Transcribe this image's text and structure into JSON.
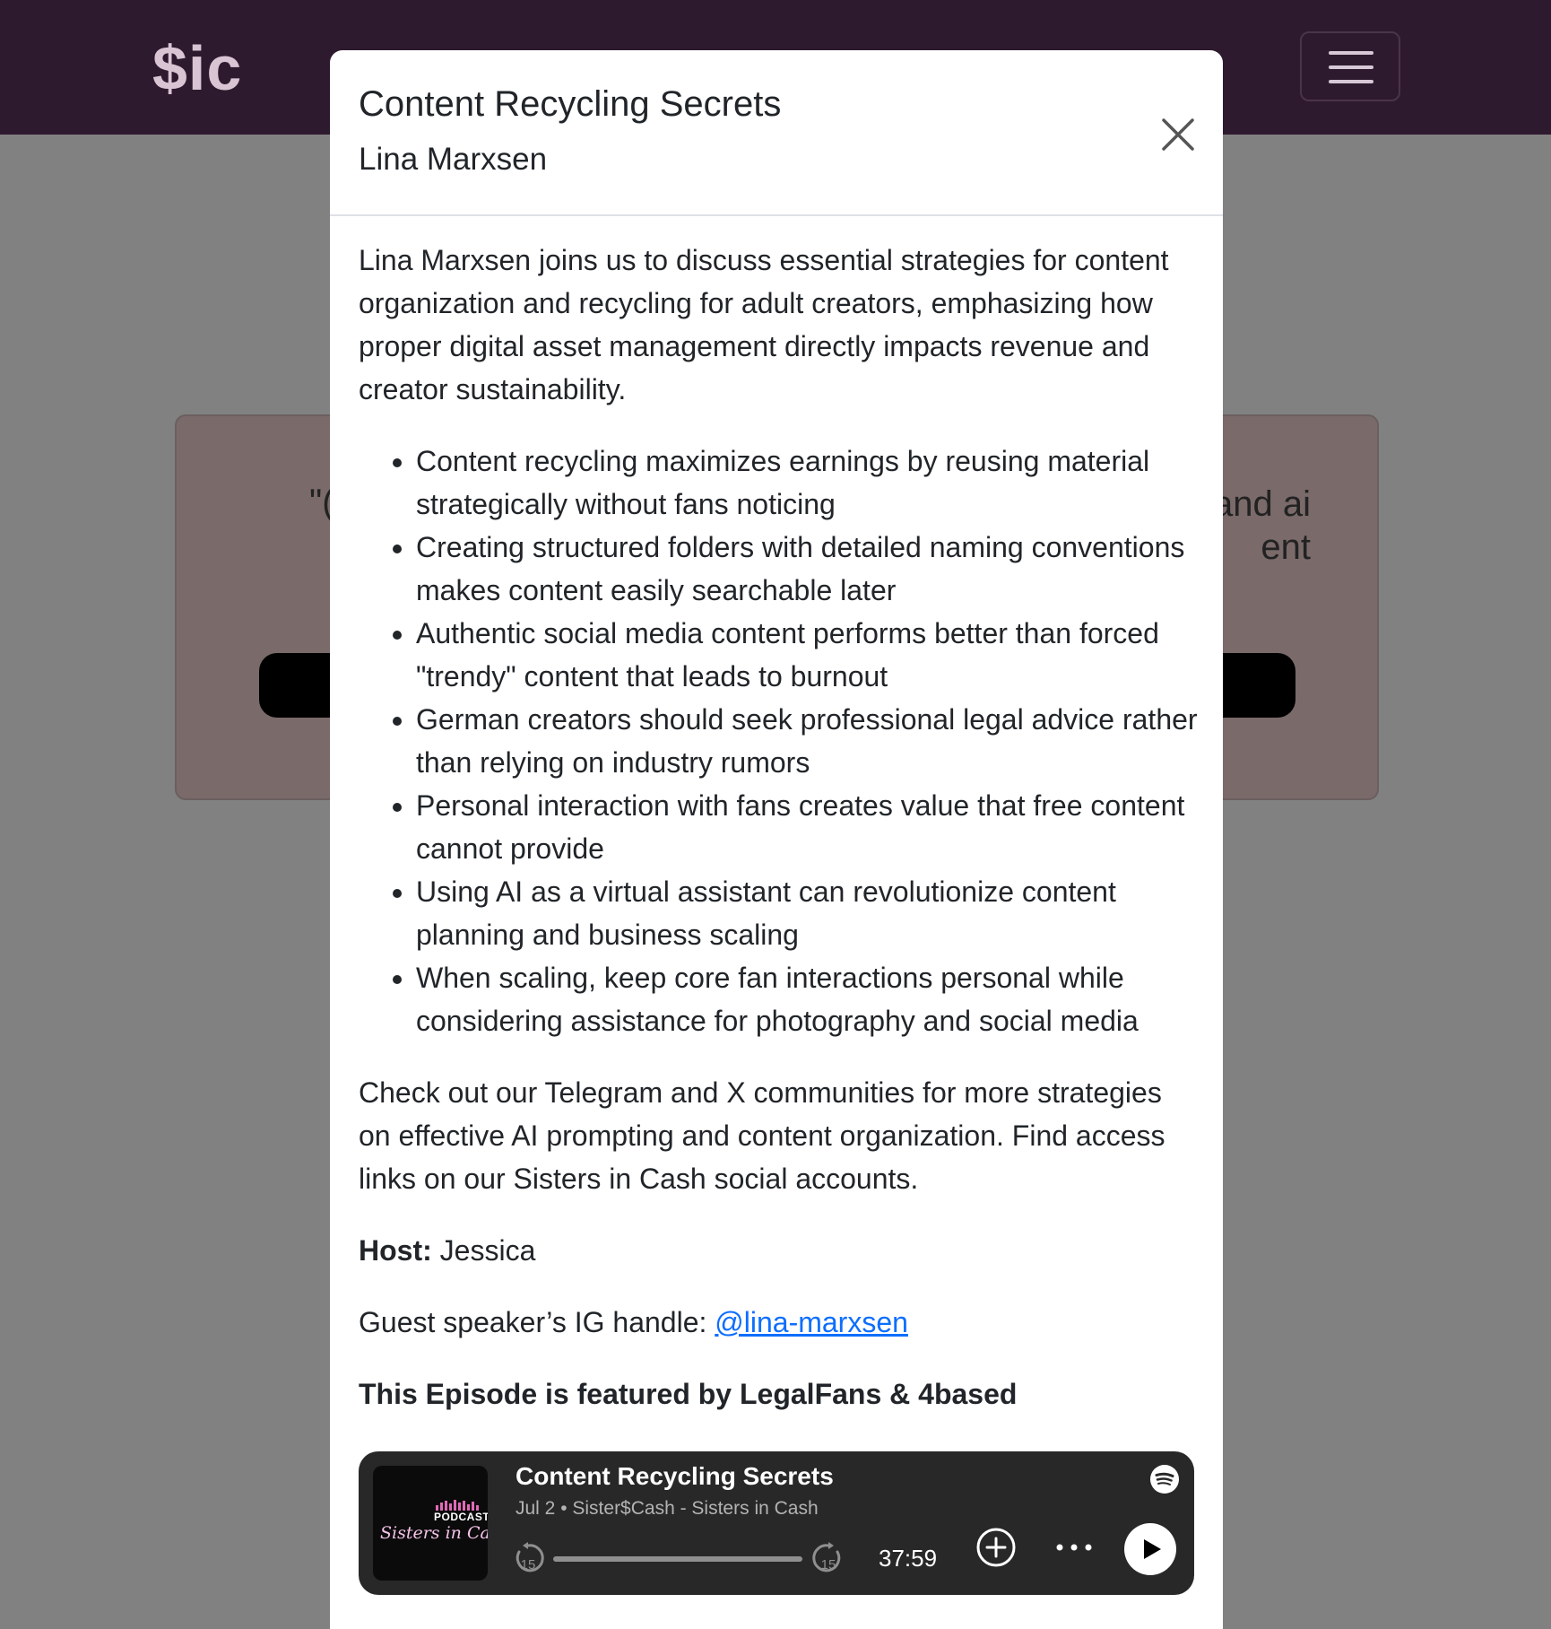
{
  "background": {
    "brand": "$ic",
    "card_left_fragment": "\"(",
    "card_right_fragment_1": "and ai",
    "card_right_fragment_2": "ent"
  },
  "modal": {
    "title": "Content Recycling Secrets",
    "subtitle": "Lina Marxsen",
    "intro": "Lina Marxsen joins us to discuss essential strategies for content organization and recycling for adult creators, emphasizing how proper digital asset management directly impacts revenue and creator sustainability.",
    "bullets": [
      "Content recycling maximizes earnings by reusing material strategically without fans noticing",
      "Creating structured folders with detailed naming conventions makes content easily searchable later",
      "Authentic social media content performs better than forced \"trendy\" content that leads to burnout",
      "German creators should seek professional legal advice rather than relying on industry rumors",
      "Personal interaction with fans creates value that free content cannot provide",
      "Using AI as a virtual assistant can revolutionize content planning and business scaling",
      "When scaling, keep core fan interactions personal while considering assistance for photography and social media"
    ],
    "community": "Check out our Telegram and X communities for more strategies on effective AI prompting and content organization. Find access links on our Sisters in Cash social accounts.",
    "host_label": "Host:",
    "host_name": " Jessica",
    "ig_label": "Guest speaker’s IG handle: ",
    "ig_handle": "@lina-marxsen",
    "featured": "This Episode is featured by LegalFans & 4based"
  },
  "player": {
    "title": "Content Recycling Secrets",
    "meta": "Jul 2 • Sister$Cash - Sisters in Cash",
    "time": "37:59",
    "cover_podcast": "PODCAST",
    "cover_name": "Sisters in Cash",
    "skip_back": "15",
    "skip_forward": "15",
    "progress": 0
  }
}
